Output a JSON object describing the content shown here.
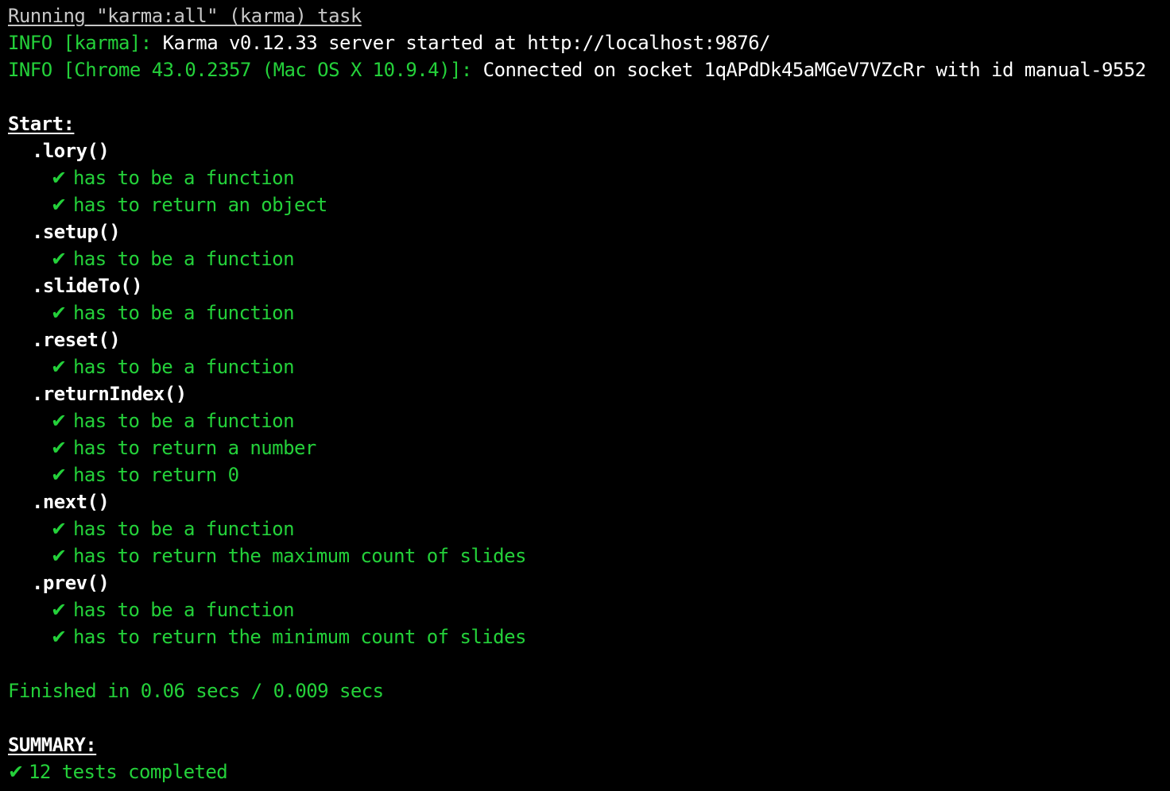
{
  "terminal": {
    "running_line": "Running \"karma:all\" (karma) task",
    "info1_prefix": "INFO [karma]:",
    "info1_message": " Karma v0.12.33 server started at http://localhost:9876/",
    "info2_prefix": "INFO [Chrome 43.0.2357 (Mac OS X 10.9.4)]:",
    "info2_message": " Connected on socket 1qAPdDk45aMGeV7VZcRr with id manual-9552",
    "start_label": "Start:",
    "check_glyph": "✔",
    "groups": [
      {
        "name": ".lory()",
        "tests": [
          "has to be a function",
          "has to return an object"
        ]
      },
      {
        "name": ".setup()",
        "tests": [
          "has to be a function"
        ]
      },
      {
        "name": ".slideTo()",
        "tests": [
          "has to be a function"
        ]
      },
      {
        "name": ".reset()",
        "tests": [
          "has to be a function"
        ]
      },
      {
        "name": ".returnIndex()",
        "tests": [
          "has to be a function",
          "has to return a number",
          "has to return 0"
        ]
      },
      {
        "name": ".next()",
        "tests": [
          "has to be a function",
          "has to return the maximum count of slides"
        ]
      },
      {
        "name": ".prev()",
        "tests": [
          "has to be a function",
          "has to return the minimum count of slides"
        ]
      }
    ],
    "finished_line": "Finished in 0.06 secs / 0.009 secs",
    "summary_label": "SUMMARY:",
    "summary_result": "12 tests completed"
  },
  "colors": {
    "background": "#000000",
    "text": "#f2f2f2",
    "pass_green": "#24d13a",
    "muted": "#c7c7c7"
  }
}
